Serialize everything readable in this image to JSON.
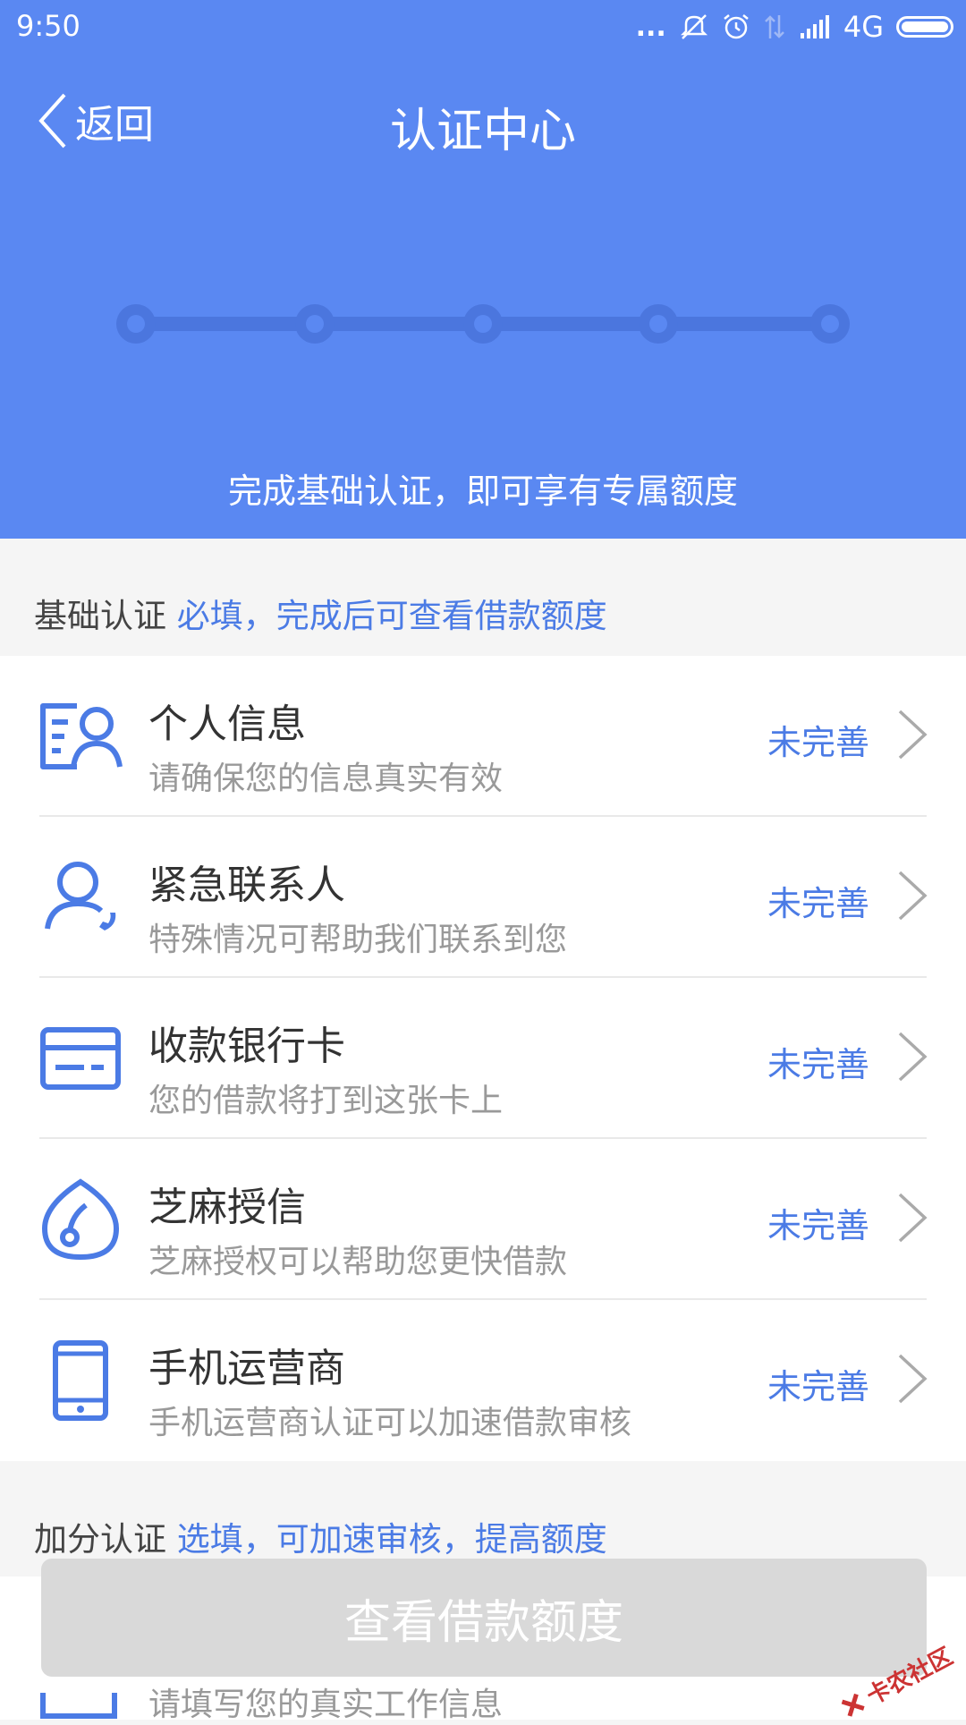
{
  "status_bar": {
    "time": "9:50",
    "dots": "...",
    "network": "4G",
    "icons": [
      "mute-icon",
      "alarm-icon",
      "data-arrows-icon",
      "signal-icon",
      "battery-icon"
    ]
  },
  "nav": {
    "back_label": "返回",
    "title": "认证中心"
  },
  "progress": {
    "steps": 5,
    "completed": 0
  },
  "header_tip": "完成基础认证，即可享有专属额度",
  "basic_section": {
    "title": "基础认证",
    "hint": "必填，完成后可查看借款额度",
    "items": [
      {
        "icon": "personal-info-icon",
        "title": "个人信息",
        "subtitle": "请确保您的信息真实有效",
        "status": "未完善"
      },
      {
        "icon": "contact-person-icon",
        "title": "紧急联系人",
        "subtitle": "特殊情况可帮助我们联系到您",
        "status": "未完善"
      },
      {
        "icon": "bank-card-icon",
        "title": "收款银行卡",
        "subtitle": "您的借款将打到这张卡上",
        "status": "未完善"
      },
      {
        "icon": "sesame-credit-icon",
        "title": "芝麻授信",
        "subtitle": "芝麻授权可以帮助您更快借款",
        "status": "未完善"
      },
      {
        "icon": "mobile-phone-icon",
        "title": "手机运营商",
        "subtitle": "手机运营商认证可以加速借款审核",
        "status": "未完善"
      }
    ]
  },
  "bonus_section": {
    "title": "加分认证",
    "hint": "选填，可加速审核，提高额度",
    "partial_item_subtitle": "请填写您的真实工作信息"
  },
  "cta_label": "查看借款额度",
  "watermark": "卡农社区",
  "colors": {
    "header_bg": "#5a88f2",
    "accent": "#4b7be5",
    "cta_disabled": "#d9d9d9"
  }
}
